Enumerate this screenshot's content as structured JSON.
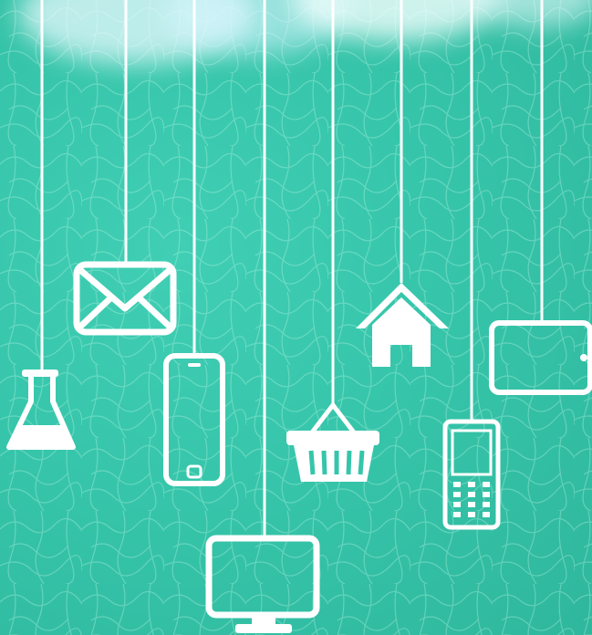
{
  "scene": {
    "description_colors": {
      "background": "#36c5aa",
      "icon": "#ffffff",
      "cloud": "#e8fbff"
    },
    "hanging_icons": [
      {
        "icon": "flask-icon"
      },
      {
        "icon": "envelope-icon"
      },
      {
        "icon": "smartphone-icon"
      },
      {
        "icon": "monitor-icon"
      },
      {
        "icon": "shopping-basket-icon"
      },
      {
        "icon": "house-icon"
      },
      {
        "icon": "mobile-phone-icon"
      },
      {
        "icon": "tablet-icon"
      }
    ]
  }
}
